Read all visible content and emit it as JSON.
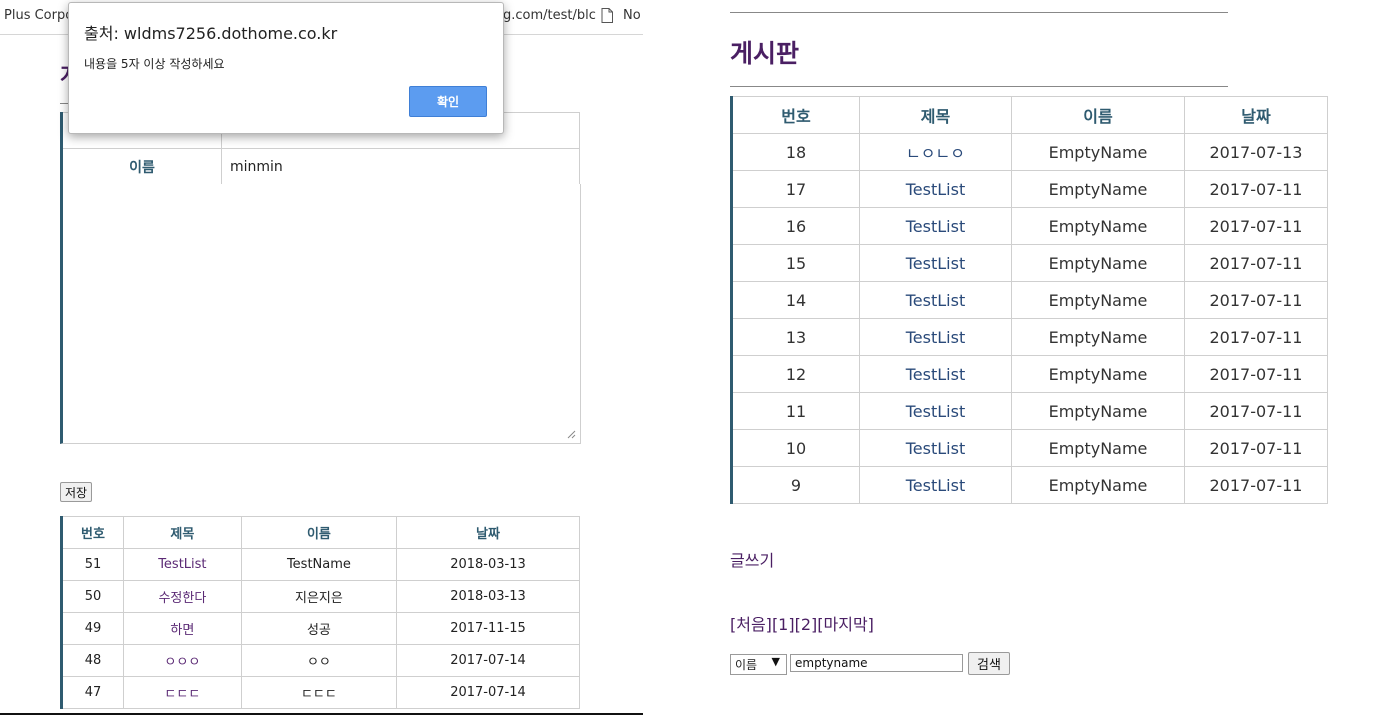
{
  "left": {
    "bookmarks": {
      "item1": "Plus Corpo",
      "url_fragment": "g.com/test/blc",
      "item2": "No"
    },
    "title": "게",
    "form": {
      "name_label": "이름",
      "name_value": "minmin"
    },
    "save_label": "저장",
    "list": {
      "headers": [
        "번호",
        "제목",
        "이름",
        "날짜"
      ],
      "rows": [
        [
          "51",
          "TestList",
          "TestName",
          "2018-03-13"
        ],
        [
          "50",
          "수정한다",
          "지은지은",
          "2018-03-13"
        ],
        [
          "49",
          "하면",
          "성공",
          "2017-11-15"
        ],
        [
          "48",
          "ㅇㅇㅇ",
          "ㅇㅇ",
          "2017-07-14"
        ],
        [
          "47",
          "ㄷㄷㄷ",
          "ㄷㄷㄷ",
          "2017-07-14"
        ]
      ]
    }
  },
  "dialog": {
    "title": "출처: wldms7256.dothome.co.kr",
    "message": "내용을 5자 이상 작성하세요",
    "ok_label": "확인",
    "accent": "#5c9cf0"
  },
  "right": {
    "title": "게시판",
    "list": {
      "headers": [
        "번호",
        "제목",
        "이름",
        "날짜"
      ],
      "rows": [
        [
          "18",
          "ㄴㅇㄴㅇ",
          "EmptyName",
          "2017-07-13"
        ],
        [
          "17",
          "TestList",
          "EmptyName",
          "2017-07-11"
        ],
        [
          "16",
          "TestList",
          "EmptyName",
          "2017-07-11"
        ],
        [
          "15",
          "TestList",
          "EmptyName",
          "2017-07-11"
        ],
        [
          "14",
          "TestList",
          "EmptyName",
          "2017-07-11"
        ],
        [
          "13",
          "TestList",
          "EmptyName",
          "2017-07-11"
        ],
        [
          "12",
          "TestList",
          "EmptyName",
          "2017-07-11"
        ],
        [
          "11",
          "TestList",
          "EmptyName",
          "2017-07-11"
        ],
        [
          "10",
          "TestList",
          "EmptyName",
          "2017-07-11"
        ],
        [
          "9",
          "TestList",
          "EmptyName",
          "2017-07-11"
        ]
      ]
    },
    "write_label": "글쓰기",
    "pager": {
      "first": "[처음]",
      "pages": [
        "[1]",
        "[2]"
      ],
      "last": "[마지막]"
    },
    "search": {
      "field": "이름",
      "query": "emptyname",
      "button": "검색"
    }
  },
  "colors": {
    "title_purple": "#4a1f63",
    "table_accent": "#2f5b70",
    "link": "#2a4a7a"
  }
}
